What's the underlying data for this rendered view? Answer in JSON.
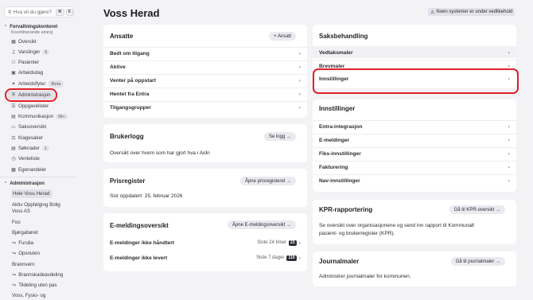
{
  "search": {
    "placeholder": "Hva vil du gjøre?",
    "kbd1": "⌘",
    "kbd2": "K"
  },
  "sidebar": {
    "section1": {
      "title": "Forvaltningskontoret",
      "subtitle": "Koordinerande eining"
    },
    "items": [
      {
        "label": "Oversikt",
        "icon": "grid-icon"
      },
      {
        "label": "Varslinger",
        "badge": "5",
        "icon": "bell-icon"
      },
      {
        "label": "Pasienter",
        "icon": "users-icon"
      },
      {
        "label": "Arbeidsdag",
        "icon": "briefcase-icon"
      },
      {
        "label": "Arbeidsflyter",
        "badge": "Beta",
        "icon": "sparkle-icon"
      },
      {
        "label": "Administrasjon",
        "icon": "shield-icon"
      },
      {
        "label": "Oppgavelister",
        "icon": "list-icon"
      },
      {
        "label": "Kommunikasjon",
        "badge": "99+",
        "icon": "message-icon"
      },
      {
        "label": "Saksoversikt",
        "icon": "folder-icon"
      },
      {
        "label": "Klagesaker",
        "icon": "gavel-icon"
      },
      {
        "label": "Søknader",
        "badge": "1",
        "icon": "doc-icon"
      },
      {
        "label": "Venteliste",
        "icon": "clock-icon"
      },
      {
        "label": "Egenandeler",
        "icon": "table-icon"
      }
    ],
    "section2": {
      "title": "Administrasjon"
    },
    "sub_items": [
      {
        "label": "Hele Voss Herad",
        "prefix": ""
      },
      {
        "label": "Aktiv Oppfølging Bolig",
        "prefix": ""
      },
      {
        "label": "Voss AS",
        "prefix": ""
      },
      {
        "label": "Foo",
        "prefix": ""
      },
      {
        "label": "Bjørgabøret",
        "prefix": ""
      },
      {
        "label": "Furulia",
        "prefix": "↪"
      },
      {
        "label": "Opsnuten",
        "prefix": "↪"
      },
      {
        "label": "Brannvern",
        "prefix": ""
      },
      {
        "label": "Brannskadeavdeling",
        "prefix": "↪"
      },
      {
        "label": "Tildeling uten pas",
        "prefix": "↪"
      },
      {
        "label": "Voss, Fysio- og",
        "prefix": ""
      }
    ]
  },
  "main": {
    "title": "Voss Herad",
    "status": "Noen systemer er under vedlikehold",
    "ansatte": {
      "title": "Ansatte",
      "add_button": "+ Ansatt",
      "rows": [
        "Bedt om tilgang",
        "Aktive",
        "Venter på oppstart",
        "Hentet fra Entra",
        "Tilgangsgrupper"
      ]
    },
    "brukerlogg": {
      "title": "Brukerlogg",
      "button": "Se logg →",
      "text": "Oversikt over hvem som har gjort hva i Aidn"
    },
    "prisregister": {
      "title": "Prisregister",
      "button": "Åpne prisregisteret →",
      "text": "Sist oppdatert: 25. februar 2026"
    },
    "emelding": {
      "title": "E-meldingsoversikt",
      "button": "Åpne E-meldingsoversikt →",
      "rows": [
        {
          "label": "E-meldinger ikke håndtert",
          "meta": "Siste 24 timer",
          "count": "23"
        },
        {
          "label": "E-meldinger ikke levert",
          "meta": "Siste 7 dager",
          "count": "119"
        }
      ]
    },
    "saksbehandling": {
      "title": "Saksbehandling",
      "rows": [
        "Vedtaksmaler",
        "Brevmaler",
        "Innstillinger"
      ]
    },
    "innstillinger": {
      "title": "Innstillinger",
      "rows": [
        "Entra-integrasjon",
        "E-meldinger",
        "Fiks-innstillinger",
        "Fakturering",
        "Nav-innstillinger"
      ]
    },
    "kpr": {
      "title": "KPR-rapportering",
      "button": "Gå til KPR-oversikt →",
      "text1": "Se oversikt over organisasjonene og send inn rapport til Kommunalt",
      "text2": "pasient- og brukerregister (KPR)."
    },
    "journal": {
      "title": "Journalmaler",
      "button": "Gå til journalmaler →",
      "text": "Administrer journalmaler for kommunen."
    }
  },
  "colors": {
    "accent_red": "#e0202a",
    "background": "#f3f2f5"
  }
}
